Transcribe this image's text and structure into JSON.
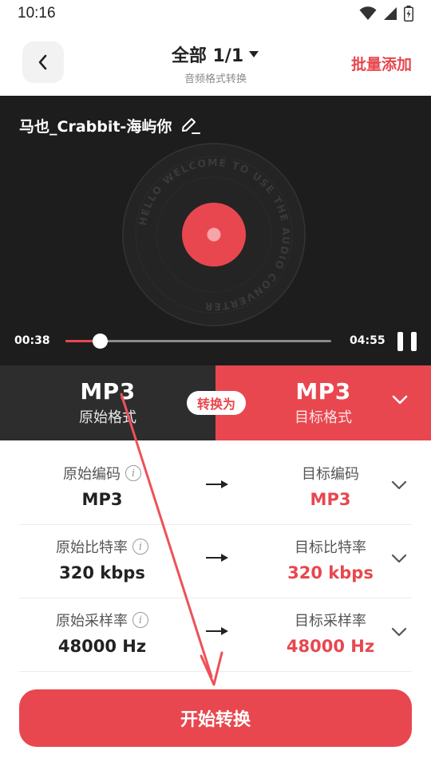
{
  "status_bar": {
    "time": "10:16",
    "icons": [
      "wifi-icon",
      "signal-icon",
      "battery-charging-icon"
    ]
  },
  "header": {
    "title": "全部 1/1",
    "subtitle": "音频格式转换",
    "batch_add_label": "批量添加",
    "icons": [
      "chevron-left-icon",
      "caret-down-icon"
    ]
  },
  "player": {
    "track_name": "马也_Crabbit-海屿你",
    "disc_text": "HELLO WELCOME TO USE THE AUDIO CONVERTER",
    "current_time": "00:38",
    "total_time": "04:55",
    "progress_fraction": 0.13,
    "icons": [
      "edit-icon",
      "pause-icon"
    ]
  },
  "format": {
    "source_value": "MP3",
    "source_caption": "原始格式",
    "convert_label": "转换为",
    "target_value": "MP3",
    "target_caption": "目标格式"
  },
  "params": [
    {
      "source_label": "原始编码",
      "source_value": "MP3",
      "target_label": "目标编码",
      "target_value": "MP3"
    },
    {
      "source_label": "原始比特率",
      "source_value": "320 kbps",
      "target_label": "目标比特率",
      "target_value": "320 kbps"
    },
    {
      "source_label": "原始采样率",
      "source_value": "48000 Hz",
      "target_label": "目标采样率",
      "target_value": "48000 Hz"
    }
  ],
  "actions": {
    "start_label": "开始转换"
  },
  "colors": {
    "accent": "#e8474f",
    "player_bg": "#1d1d1d",
    "source_band": "#2d2d2d"
  }
}
